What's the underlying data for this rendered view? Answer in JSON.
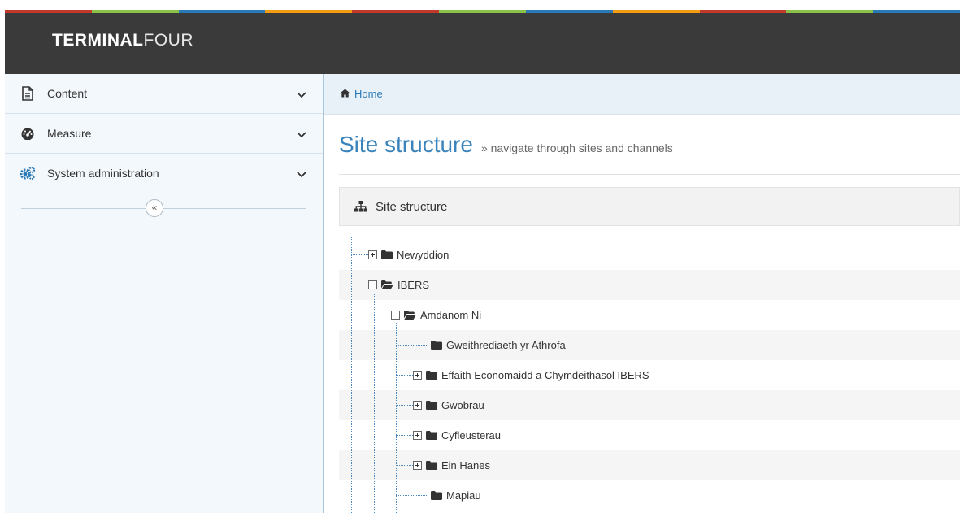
{
  "header": {
    "logo_bold": "TERMINAL",
    "logo_thin": "FOUR"
  },
  "colors": {
    "strip": [
      "#c0392b",
      "#8bc34a",
      "#2a79b7",
      "#f39c12",
      "#c0392b",
      "#8bc34a",
      "#2a79b7",
      "#f39c12",
      "#c0392b",
      "#8bc34a",
      "#2a79b7"
    ]
  },
  "sidebar": {
    "items": [
      {
        "label": "Content",
        "icon": "document-icon"
      },
      {
        "label": "Measure",
        "icon": "dashboard-icon"
      },
      {
        "label": "System administration",
        "icon": "cogs-icon"
      }
    ],
    "collapse_glyph": "«"
  },
  "breadcrumb": {
    "home": "Home"
  },
  "page": {
    "title": "Site structure",
    "subtitle": "» navigate through sites and channels"
  },
  "panel": {
    "title": "Site structure"
  },
  "tree": [
    {
      "label": "Newyddion",
      "toggle": "plus",
      "open": false
    },
    {
      "label": "IBERS",
      "toggle": "minus",
      "open": true
    },
    {
      "label": "Amdanom Ni",
      "toggle": "minus",
      "open": true
    },
    {
      "label": "Gweithrediaeth yr Athrofa",
      "toggle": "none",
      "open": false
    },
    {
      "label": "Effaith Economaidd a Chymdeithasol IBERS",
      "toggle": "plus",
      "open": false
    },
    {
      "label": "Gwobrau",
      "toggle": "plus",
      "open": false
    },
    {
      "label": "Cyfleusterau",
      "toggle": "plus",
      "open": false
    },
    {
      "label": "Ein Hanes",
      "toggle": "plus",
      "open": false
    },
    {
      "label": "Mapiau",
      "toggle": "none",
      "open": false
    }
  ]
}
